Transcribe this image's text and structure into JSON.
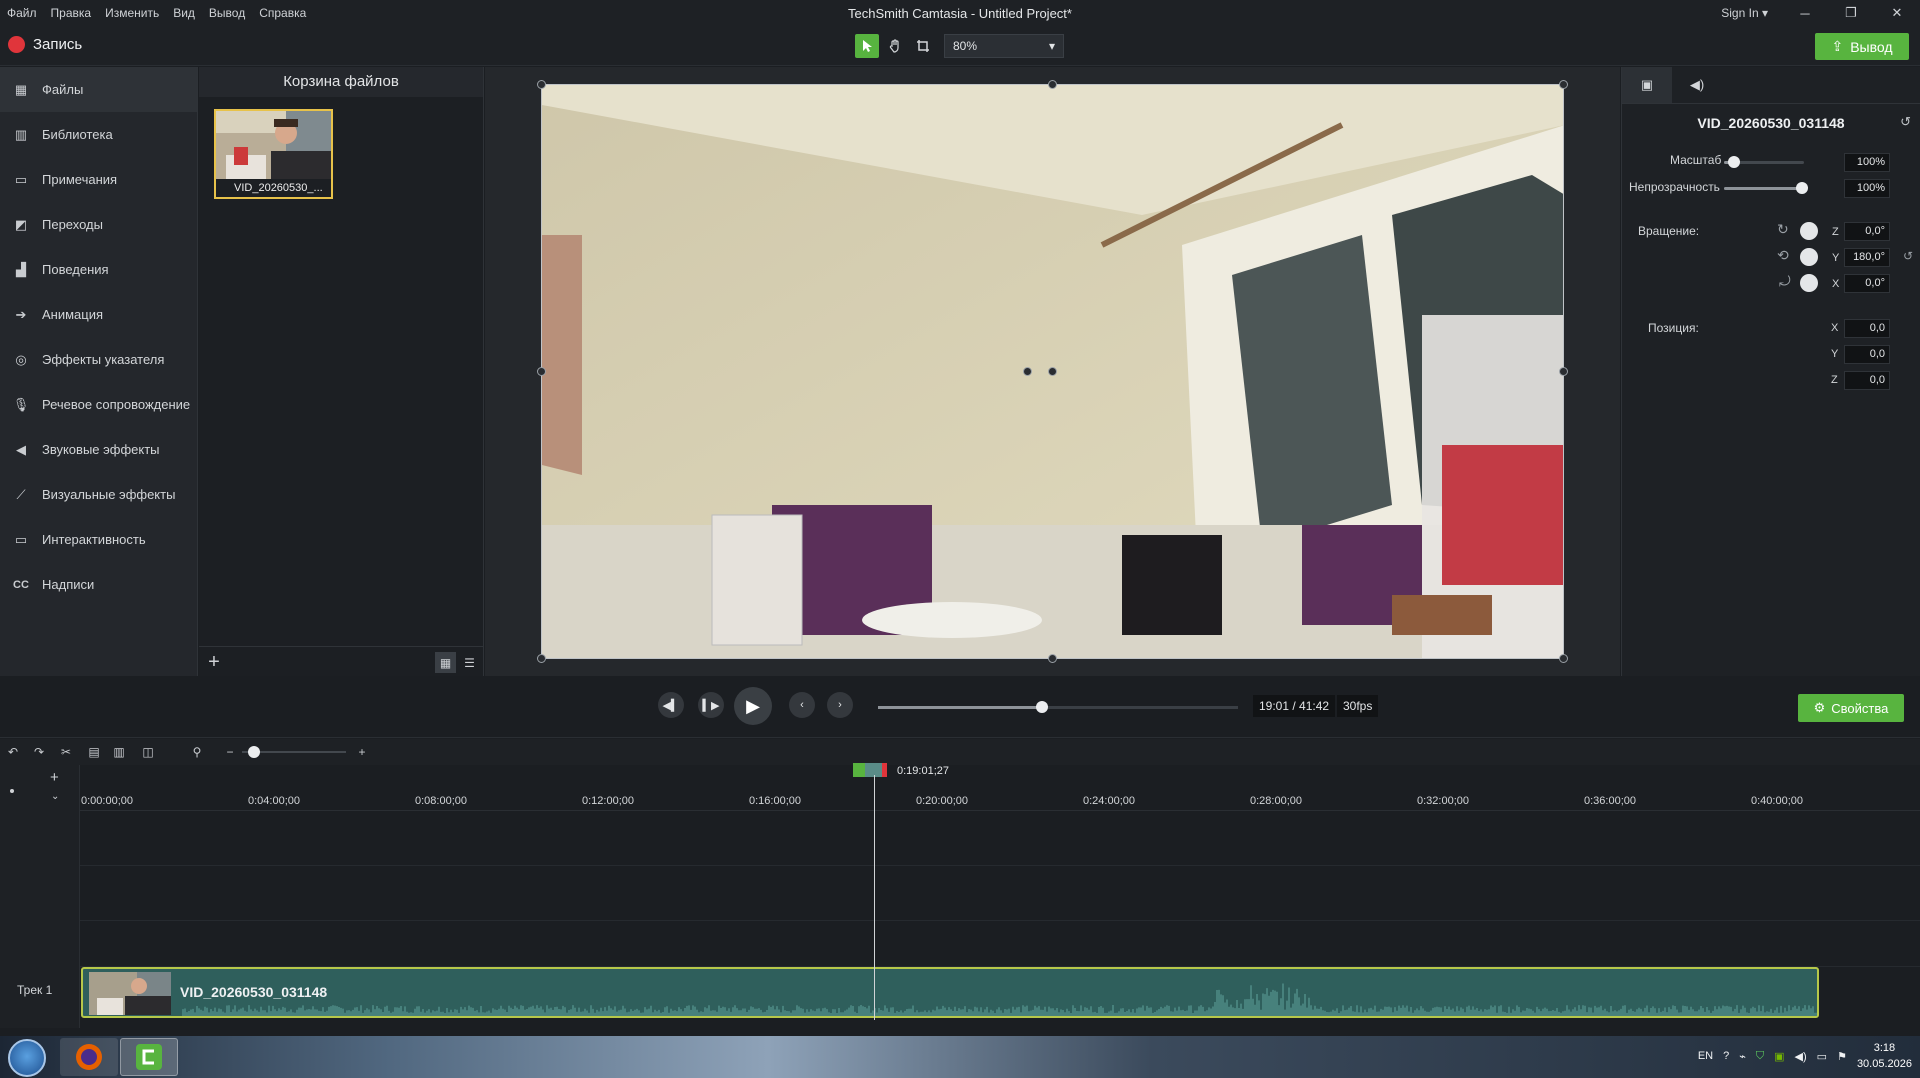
{
  "window": {
    "title": "TechSmith Camtasia - Untitled Project*",
    "signin": "Sign In",
    "menus": [
      "Файл",
      "Правка",
      "Изменить",
      "Вид",
      "Вывод",
      "Справка"
    ]
  },
  "toolbar": {
    "record_label": "Запись",
    "zoom_value": "80%",
    "export_label": "Вывод"
  },
  "sidebar": {
    "items": [
      {
        "label": "Файлы",
        "icon": "film-icon"
      },
      {
        "label": "Библиотека",
        "icon": "library-icon"
      },
      {
        "label": "Примечания",
        "icon": "callout-icon"
      },
      {
        "label": "Переходы",
        "icon": "transition-icon"
      },
      {
        "label": "Поведения",
        "icon": "behavior-icon"
      },
      {
        "label": "Анимация",
        "icon": "animation-icon"
      },
      {
        "label": "Эффекты указателя",
        "icon": "cursor-icon"
      },
      {
        "label": "Речевое сопровождение",
        "icon": "microphone-icon"
      },
      {
        "label": "Звуковые эффекты",
        "icon": "speaker-icon"
      },
      {
        "label": "Визуальные эффекты",
        "icon": "wand-icon"
      },
      {
        "label": "Интерактивность",
        "icon": "interactive-icon"
      },
      {
        "label": "Надписи",
        "icon": "cc-icon"
      }
    ]
  },
  "bin": {
    "header": "Корзина файлов",
    "thumb_label": "VID_20260530_..."
  },
  "properties": {
    "title": "VID_20260530_031148",
    "scale_label": "Масштаб",
    "scale_value": "100%",
    "opacity_label": "Непрозрачность",
    "opacity_value": "100%",
    "rotation_label": "Вращение:",
    "rot_z": "0,0°",
    "rot_y": "180,0°",
    "rot_x": "0,0°",
    "position_label": "Позиция:",
    "pos_x": "0,0",
    "pos_y": "0,0",
    "pos_z": "0,0",
    "button_label": "Свойства"
  },
  "playback": {
    "time": "19:01 / 41:42",
    "fps": "30fps",
    "progress": 0.456
  },
  "timeline": {
    "playhead_time": "0:19:01;27",
    "ticks": [
      "0:00:00;00",
      "0:04:00;00",
      "0:08:00;00",
      "0:12:00;00",
      "0:16:00;00",
      "0:20:00;00",
      "0:24:00;00",
      "0:28:00;00",
      "0:32:00;00",
      "0:36:00;00",
      "0:40:00;00"
    ],
    "track_label": "Трек 1",
    "clip_name": "VID_20260530_031148"
  },
  "taskbar": {
    "lang": "EN",
    "time": "3:18",
    "date": "30.05.2026"
  },
  "colors": {
    "accent_green": "#58b43f",
    "record_red": "#e0353b",
    "clip_teal": "#2f5f5c"
  }
}
